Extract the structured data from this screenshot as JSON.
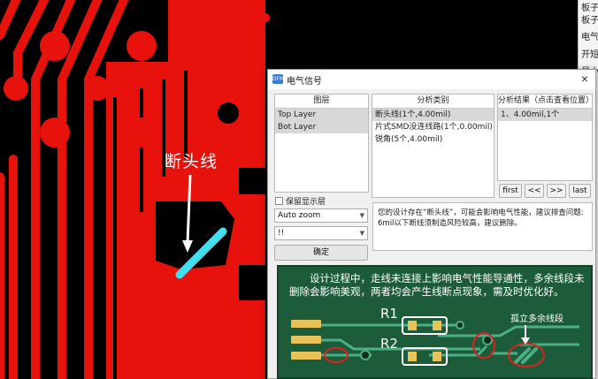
{
  "callout": {
    "label": "断头线"
  },
  "side_panel": {
    "items": [
      "板子",
      "板子厚",
      "电气",
      "开短",
      "最小"
    ]
  },
  "dialog": {
    "title": "电气信号",
    "app_icon_text": "DFM",
    "close": "×",
    "layers": {
      "header": "图层",
      "items": [
        "Top Layer",
        "Bot Layer"
      ]
    },
    "categories": {
      "header": "分析类别",
      "items": [
        "断头线(1个,4.00mil)",
        "片式SMD没连线路(1个,0.00mil)",
        "锐角(5个,4.00mil)"
      ]
    },
    "results": {
      "header": "分析结果（点击查看位置）",
      "items": [
        "1、4.00mil,1个"
      ]
    },
    "nav": {
      "first": "first",
      "prev": "<<",
      "next": ">>",
      "last": "last"
    },
    "keep_layer_label": "保留显示层",
    "zoom_select": "Auto zoom",
    "secondary_select": "!!",
    "ok_label": "确定",
    "message": "您的设计存在“断头线”，可能会影响电气性能，建议排查问题: 6mil以下断线须制造风险较高，建议删除。"
  },
  "board": {
    "text": "设计过程中，走线未连接上影响电气性能导通性，多余线段未删除会影响美观，两者均会产生线断点现象，需及时优化好。",
    "r1": "R1",
    "r2": "R2",
    "isolated_label": "孤立多余线段"
  },
  "colors": {
    "pcb_red": "#e8120c",
    "trace_cyan": "#3ee0f0",
    "board_green": "#1d5c3a",
    "trace_green": "#4caf85",
    "highlight_red": "#e02020"
  }
}
